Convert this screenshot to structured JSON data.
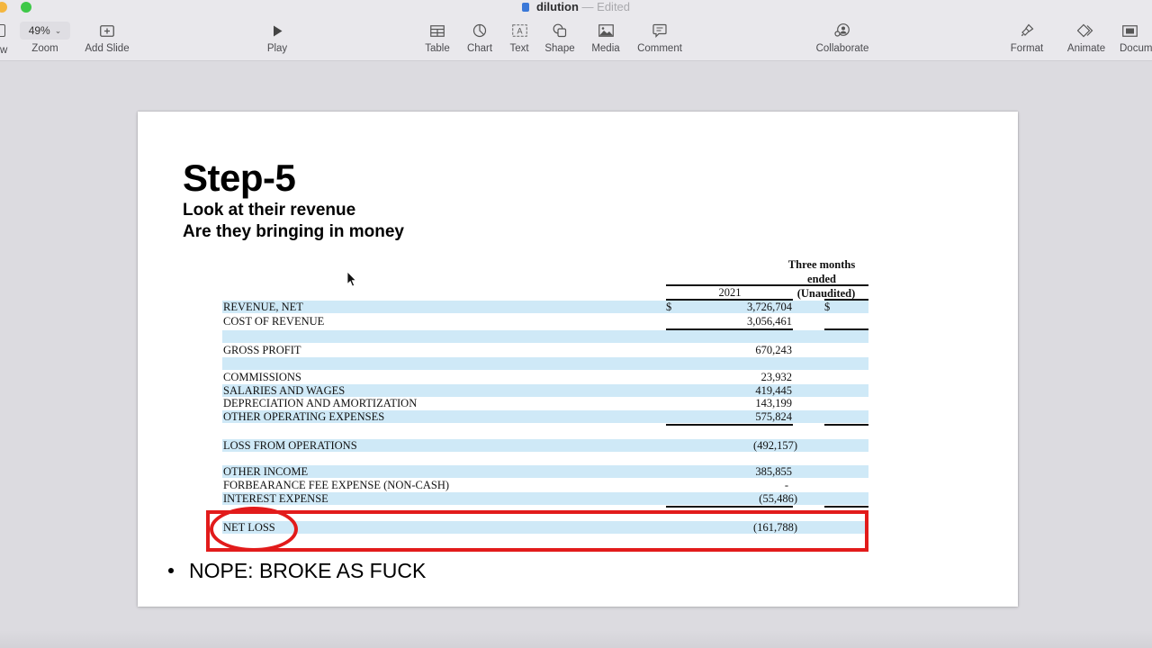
{
  "window": {
    "title": "dilution",
    "separator": "—",
    "status": "Edited"
  },
  "toolbar": {
    "partial_left_label": "w",
    "zoom": {
      "value": "49%",
      "label": "Zoom"
    },
    "items": [
      {
        "id": "add-slide",
        "label": "Add Slide",
        "icon": "add-slide-icon"
      },
      {
        "id": "play",
        "label": "Play",
        "icon": "play-icon"
      },
      {
        "id": "table",
        "label": "Table",
        "icon": "table-icon"
      },
      {
        "id": "chart",
        "label": "Chart",
        "icon": "chart-icon"
      },
      {
        "id": "text",
        "label": "Text",
        "icon": "text-box-icon"
      },
      {
        "id": "shape",
        "label": "Shape",
        "icon": "shape-icon"
      },
      {
        "id": "media",
        "label": "Media",
        "icon": "media-icon"
      },
      {
        "id": "comment",
        "label": "Comment",
        "icon": "comment-icon"
      },
      {
        "id": "collaborate",
        "label": "Collaborate",
        "icon": "collaborate-icon"
      },
      {
        "id": "format",
        "label": "Format",
        "icon": "paintbrush-icon"
      },
      {
        "id": "animate",
        "label": "Animate",
        "icon": "animate-icon"
      },
      {
        "id": "document",
        "label": "Docum",
        "icon": "document-icon"
      }
    ]
  },
  "slide": {
    "title": "Step-5",
    "subtitle_lines": [
      "Look at their revenue",
      "Are they bringing in money"
    ],
    "table": {
      "header_line1": "Three months ended",
      "header_line2": "(Unaudited)",
      "year": "2021",
      "currency_symbol": "$",
      "rows": [
        {
          "label": "REVENUE, NET",
          "value": "3,726,704"
        },
        {
          "label": "COST OF REVENUE",
          "value": "3,056,461"
        },
        {
          "label": "GROSS PROFIT",
          "value": "670,243"
        },
        {
          "label": "COMMISSIONS",
          "value": "23,932"
        },
        {
          "label": "SALARIES AND WAGES",
          "value": "419,445"
        },
        {
          "label": "DEPRECIATION AND AMORTIZATION",
          "value": "143,199"
        },
        {
          "label": "OTHER OPERATING EXPENSES",
          "value": "575,824"
        },
        {
          "label": "LOSS FROM OPERATIONS",
          "value": "(492,157)"
        },
        {
          "label": "OTHER INCOME",
          "value": "385,855"
        },
        {
          "label": "FORBEARANCE FEE EXPENSE (NON-CASH)",
          "value": "-"
        },
        {
          "label": "INTEREST EXPENSE",
          "value": "(55,486)"
        },
        {
          "label": "NET LOSS",
          "value": "(161,788)"
        }
      ]
    },
    "highlight_color": "#e21b1b",
    "row_shade_color": "#cfe9f7",
    "bullet": "NOPE: BROKE AS FUCK"
  }
}
